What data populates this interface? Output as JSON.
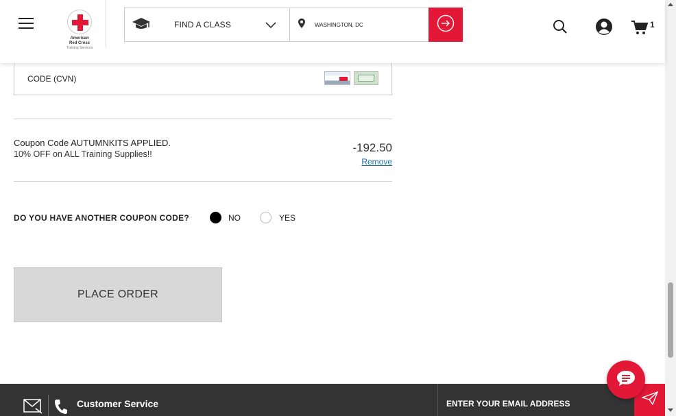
{
  "header": {
    "logo_text_1": "American",
    "logo_text_2": "Red Cross",
    "logo_text_3": "Training Services",
    "find_class_label": "FIND A CLASS",
    "location_value": "WASHINGTON, DC",
    "cart_count": "1"
  },
  "payment": {
    "cvn_label": "CODE (CVN)"
  },
  "coupon": {
    "title": "Coupon Code AUTUMNKITS APPLIED.",
    "description": "10% OFF on ALL Training Supplies!!",
    "amount": "-192.50",
    "remove_label": "Remove"
  },
  "another_coupon": {
    "question": "DO YOU HAVE ANOTHER COUPON CODE?",
    "options": [
      {
        "label": "NO",
        "selected": true
      },
      {
        "label": "YES",
        "selected": false
      }
    ]
  },
  "place_order_label": "PLACE ORDER",
  "footer": {
    "customer_service_label": "Customer Service",
    "email_placeholder": "ENTER YOUR EMAIL ADDRESS"
  },
  "colors": {
    "brand_red": "#e31837",
    "footer_bg": "#333333",
    "button_disabled_bg": "#d8d8d8",
    "link_blue": "#1a73a8"
  },
  "icons": [
    "menu-icon",
    "graduation-cap-icon",
    "chevron-down-icon",
    "location-pin-icon",
    "arrow-right-circle-icon",
    "search-icon",
    "account-icon",
    "cart-icon",
    "chat-icon",
    "mail-icon",
    "phone-icon",
    "send-icon"
  ]
}
